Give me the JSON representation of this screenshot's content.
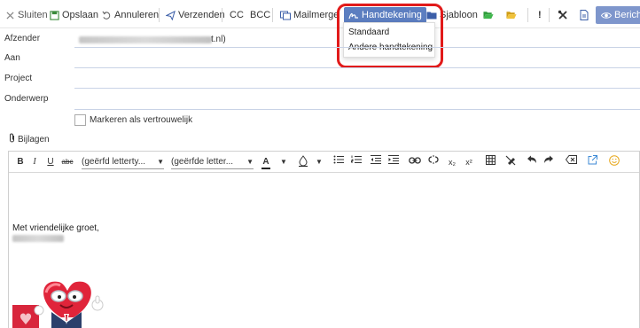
{
  "toolbar": {
    "close_label": "Sluiten",
    "save_label": "Opslaan",
    "cancel_label": "Annuleren",
    "send_label": "Verzenden",
    "cc_label": "CC",
    "bcc_label": "BCC",
    "mailmerge_label": "Mailmerge",
    "signature_label": "Handtekening",
    "template_label": "Sjabloon",
    "exclamation_label": "!",
    "message_label": "Bericht"
  },
  "signature_menu": {
    "items": [
      "Standaard",
      "Andere handtekening"
    ]
  },
  "form": {
    "sender_label": "Afzender",
    "sender_domain_suffix": "t.nl)",
    "to_label": "Aan",
    "project_label": "Project",
    "subject_label": "Onderwerp",
    "confidential_label": "Markeren als vertrouwelijk"
  },
  "attachments_label": "Bijlagen",
  "editor": {
    "bold": "B",
    "italic": "I",
    "underline": "U",
    "strikethrough": "abc",
    "font_family_placeholder": "(geërfd letterty...",
    "font_size_placeholder": "(geërfde letter...",
    "font_color": "A",
    "subscript": "x₂",
    "superscript": "x²"
  },
  "body": {
    "greeting": "Met vriendelijke groet,"
  },
  "colors": {
    "active_button": "#5c7ec0",
    "message_button": "#7e96cc",
    "highlight_frame": "#e11a1a",
    "folder_icon": "#2e9b3a",
    "folder_open_icon": "#e2b422"
  }
}
